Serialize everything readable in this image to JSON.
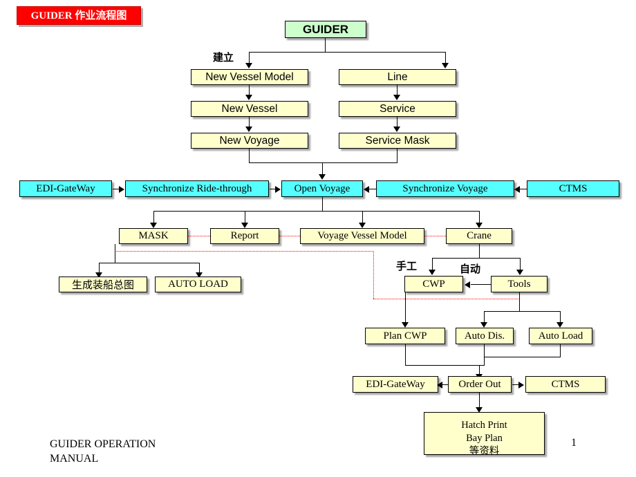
{
  "document": {
    "title_banner": "GUIDER 作业流程图",
    "footer": "GUIDER OPERATION\nMANUAL",
    "page_number": "1"
  },
  "colors": {
    "banner_bg": "#ff0000",
    "banner_text": "#ffffff",
    "green_node": "#ccffcc",
    "yellow_node": "#ffffcc",
    "cyan_node": "#55ffff",
    "connector": "#000000",
    "dotted_connector": "#ff0000"
  },
  "diagram": {
    "type": "flowchart",
    "labels": {
      "establish": "建立",
      "manual": "手工",
      "automatic": "自动"
    },
    "nodes": {
      "guider": "GUIDER",
      "new_vessel_model": "New Vessel Model",
      "line": "Line",
      "new_vessel": "New Vessel",
      "service": "Service",
      "new_voyage": "New Voyage",
      "service_mask": "Service Mask",
      "edi_gateway_top": "EDI-GateWay",
      "synchronize_ride_through": "Synchronize Ride-through",
      "open_voyage": "Open Voyage",
      "synchronize_voyage": "Synchronize Voyage",
      "ctms_top": "CTMS",
      "mask": "MASK",
      "report": "Report",
      "voyage_vessel_model": "Voyage Vessel Model",
      "crane": "Crane",
      "stowage_plan": "生成装船总图",
      "auto_load_upper": "AUTO LOAD",
      "cwp": "CWP",
      "tools": "Tools",
      "plan_cwp": "Plan CWP",
      "auto_dis": "Auto Dis.",
      "auto_load_lower": "Auto Load",
      "edi_gateway_bottom": "EDI-GateWay",
      "order_out": "Order Out",
      "ctms_bottom": "CTMS",
      "output_line1": "Hatch Print",
      "output_line2": "Bay Plan",
      "output_line3": "等资料"
    }
  }
}
